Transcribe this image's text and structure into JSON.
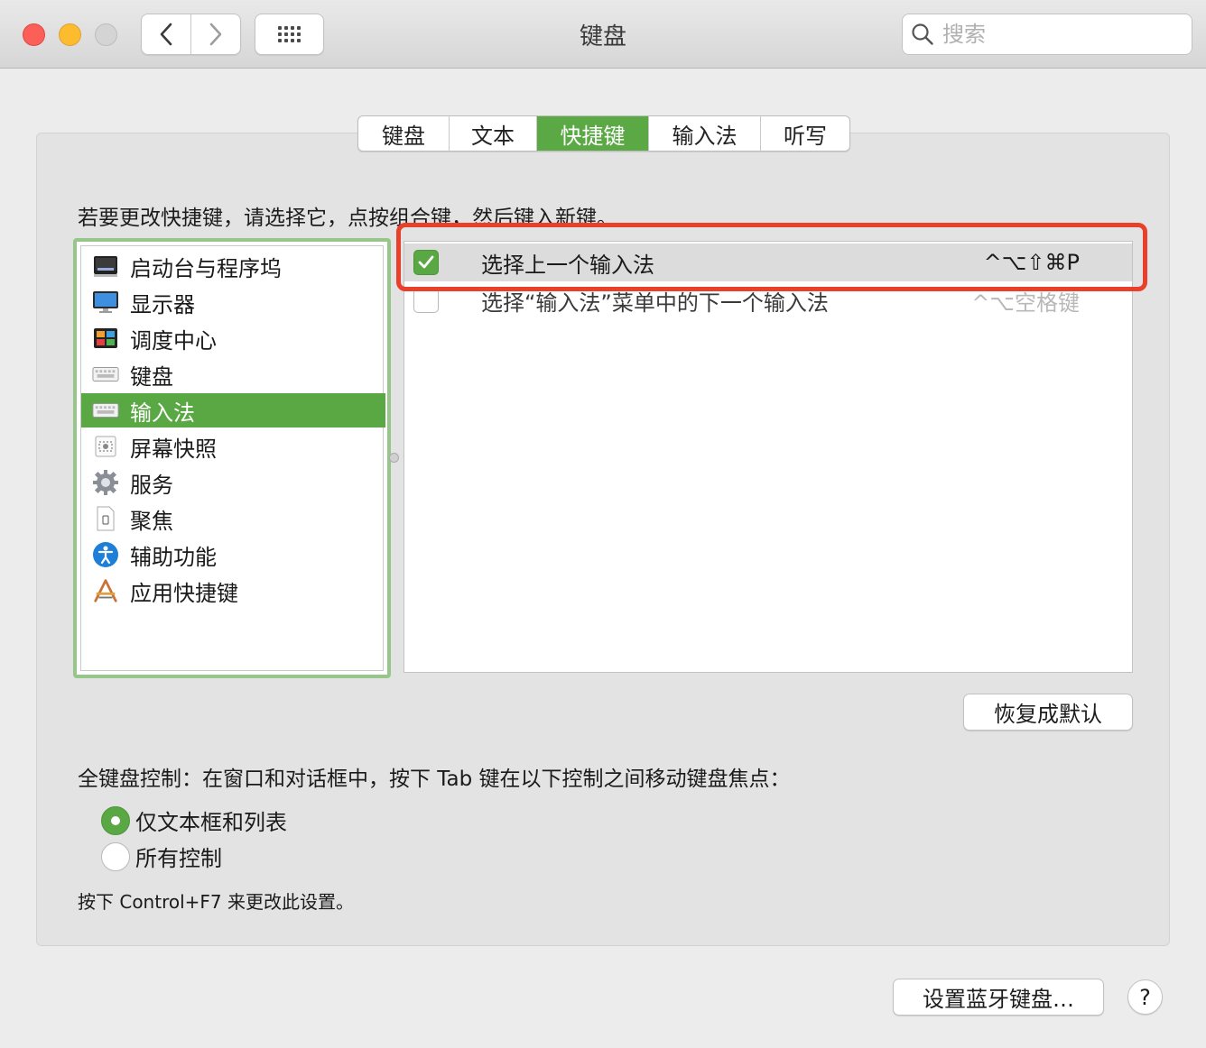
{
  "window": {
    "title": "键盘",
    "search_placeholder": "搜索",
    "nav_back": "‹",
    "nav_forward": "›"
  },
  "tabs": [
    {
      "label": "键盘",
      "active": false
    },
    {
      "label": "文本",
      "active": false
    },
    {
      "label": "快捷键",
      "active": true
    },
    {
      "label": "输入法",
      "active": false
    },
    {
      "label": "听写",
      "active": false
    }
  ],
  "instruction": "若要更改快捷键，请选择它，点按组合键，然后键入新键。",
  "sidebar": {
    "items": [
      {
        "label": "启动台与程序坞",
        "icon": "dock-icon"
      },
      {
        "label": "显示器",
        "icon": "display-icon"
      },
      {
        "label": "调度中心",
        "icon": "mission-control-icon"
      },
      {
        "label": "键盘",
        "icon": "keyboard-icon"
      },
      {
        "label": "输入法",
        "icon": "keyboard-icon",
        "selected": true
      },
      {
        "label": "屏幕快照",
        "icon": "screenshot-icon"
      },
      {
        "label": "服务",
        "icon": "gear-icon"
      },
      {
        "label": "聚焦",
        "icon": "spotlight-document-icon"
      },
      {
        "label": "辅助功能",
        "icon": "accessibility-icon"
      },
      {
        "label": "应用快捷键",
        "icon": "app-shortcuts-icon"
      }
    ]
  },
  "shortcuts": [
    {
      "label": "选择上一个输入法",
      "key": "^⌥⇧⌘P",
      "checked": true
    },
    {
      "label": "选择“输入法”菜单中的下一个输入法",
      "key": "^⌥空格键",
      "checked": false
    }
  ],
  "restore_defaults": "恢复成默认",
  "full_keyboard": {
    "title": "全键盘控制：在窗口和对话框中，按下 Tab 键在以下控制之间移动键盘焦点：",
    "options": [
      {
        "label": "仅文本框和列表",
        "selected": true
      },
      {
        "label": "所有控制",
        "selected": false
      }
    ],
    "hint": "按下 Control+F7 来更改此设置。"
  },
  "bluetooth_button": "设置蓝牙键盘…",
  "help_label": "?",
  "colors": {
    "accent": "#5aa844",
    "annotation": "#e8402a"
  }
}
